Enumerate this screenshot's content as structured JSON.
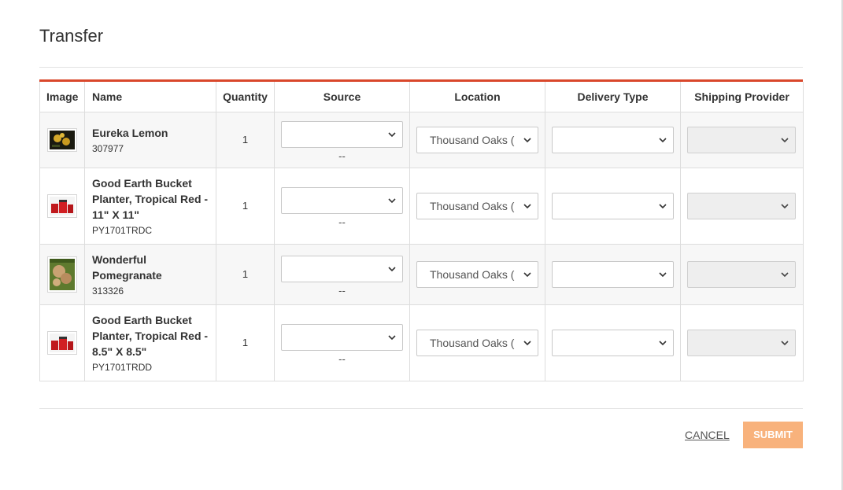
{
  "dialog": {
    "title": "Transfer",
    "cancel_label": "CANCEL",
    "submit_label": "SUBMIT"
  },
  "table": {
    "columns": [
      "Image",
      "Name",
      "Quantity",
      "Source",
      "Location",
      "Delivery Type",
      "Shipping Provider"
    ],
    "rows": [
      {
        "name": "Eureka Lemon",
        "sku": "307977",
        "quantity": "1",
        "source_value": "",
        "source_note": "--",
        "location": "Thousand Oaks (",
        "delivery_type": "",
        "shipping_provider": "",
        "thumbnail": "lemon-thumbnail"
      },
      {
        "name": "Good Earth Bucket Planter, Tropical Red - 11\" X 11\"",
        "sku": "PY1701TRDC",
        "quantity": "1",
        "source_value": "",
        "source_note": "--",
        "location": "Thousand Oaks (",
        "delivery_type": "",
        "shipping_provider": "",
        "thumbnail": "planter-thumbnail"
      },
      {
        "name": "Wonderful Pomegranate",
        "sku": "313326",
        "quantity": "1",
        "source_value": "",
        "source_note": "--",
        "location": "Thousand Oaks (",
        "delivery_type": "",
        "shipping_provider": "",
        "thumbnail": "pomegranate-thumbnail"
      },
      {
        "name": "Good Earth Bucket Planter, Tropical Red - 8.5\" X 8.5\"",
        "sku": "PY1701TRDD",
        "quantity": "1",
        "source_value": "",
        "source_note": "--",
        "location": "Thousand Oaks (",
        "delivery_type": "",
        "shipping_provider": "",
        "thumbnail": "planter-thumbnail"
      }
    ]
  },
  "colors": {
    "accent": "#d9472b",
    "submit_bg": "#f8b27c",
    "disabled_select": "#eeeeee",
    "row_stripe": "#f7f7f7"
  }
}
